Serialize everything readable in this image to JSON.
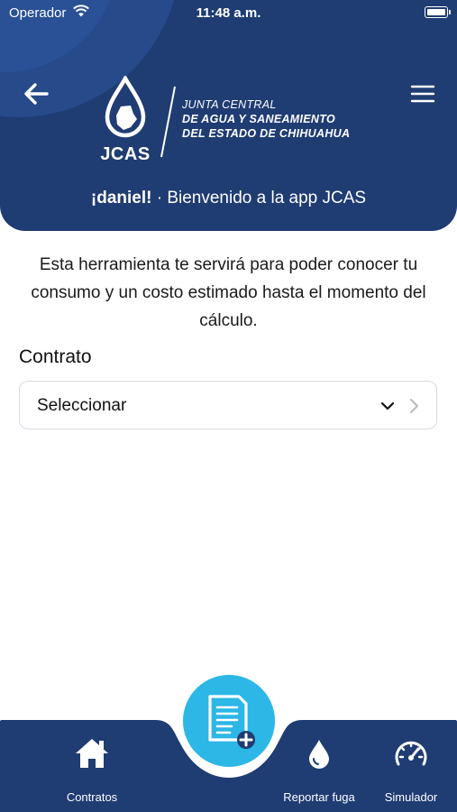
{
  "status_bar": {
    "carrier": "Operador",
    "time": "11:48 a.m."
  },
  "header": {
    "logo_text": "JCAS",
    "org_lines": [
      "JUNTA CENTRAL",
      "DE AGUA Y SANEAMIENTO",
      "DEL ESTADO DE CHIHUAHUA"
    ],
    "user_name": "¡daniel!",
    "welcome_text": " · Bienvenido a la app JCAS"
  },
  "main": {
    "intro_text": "Esta herramienta te servirá para poder conocer tu consumo y un costo estimado hasta el momento del cálculo.",
    "contract_label": "Contrato",
    "contract_select_value": "Seleccionar"
  },
  "bottom_nav": {
    "items": [
      {
        "label": "Contratos",
        "icon": "home-icon"
      },
      {
        "label": "Reportar fuga",
        "icon": "water-drop-icon"
      },
      {
        "label": "Simulador",
        "icon": "gauge-icon"
      }
    ],
    "fab_icon": "add-document-icon"
  },
  "colors": {
    "primary": "#1f3c73",
    "accent": "#2cb7e6",
    "text": "#1a1a1a",
    "border": "#d6dbe4"
  }
}
